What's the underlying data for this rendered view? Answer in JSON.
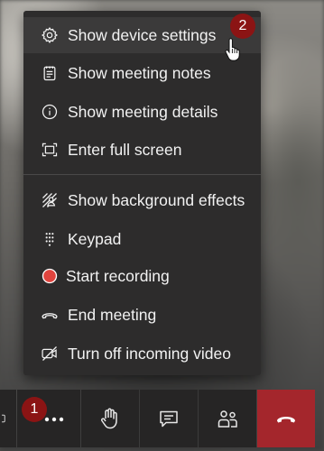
{
  "menu": {
    "items": [
      {
        "label": "Show device settings",
        "icon": "gear-icon"
      },
      {
        "label": "Show meeting notes",
        "icon": "notes-icon"
      },
      {
        "label": "Show meeting details",
        "icon": "info-icon"
      },
      {
        "label": "Enter full screen",
        "icon": "fullscreen-icon"
      },
      {
        "label": "Show background effects",
        "icon": "background-effects-icon"
      },
      {
        "label": "Keypad",
        "icon": "keypad-icon"
      },
      {
        "label": "Start recording",
        "icon": "record-icon"
      },
      {
        "label": "End meeting",
        "icon": "end-meeting-icon"
      },
      {
        "label": "Turn off incoming video",
        "icon": "video-off-icon"
      }
    ]
  },
  "badges": {
    "step1": "1",
    "step2": "2"
  },
  "toolbar": {
    "buttons": [
      "more-options-icon",
      "raise-hand-icon",
      "chat-icon",
      "participants-icon",
      "hang-up-icon"
    ]
  },
  "colors": {
    "menu_bg": "#2d2c2c",
    "hover_bg": "#3b3a3a",
    "badge": "#8b1414",
    "record": "#e0443e",
    "hang_up": "#a4262c"
  }
}
